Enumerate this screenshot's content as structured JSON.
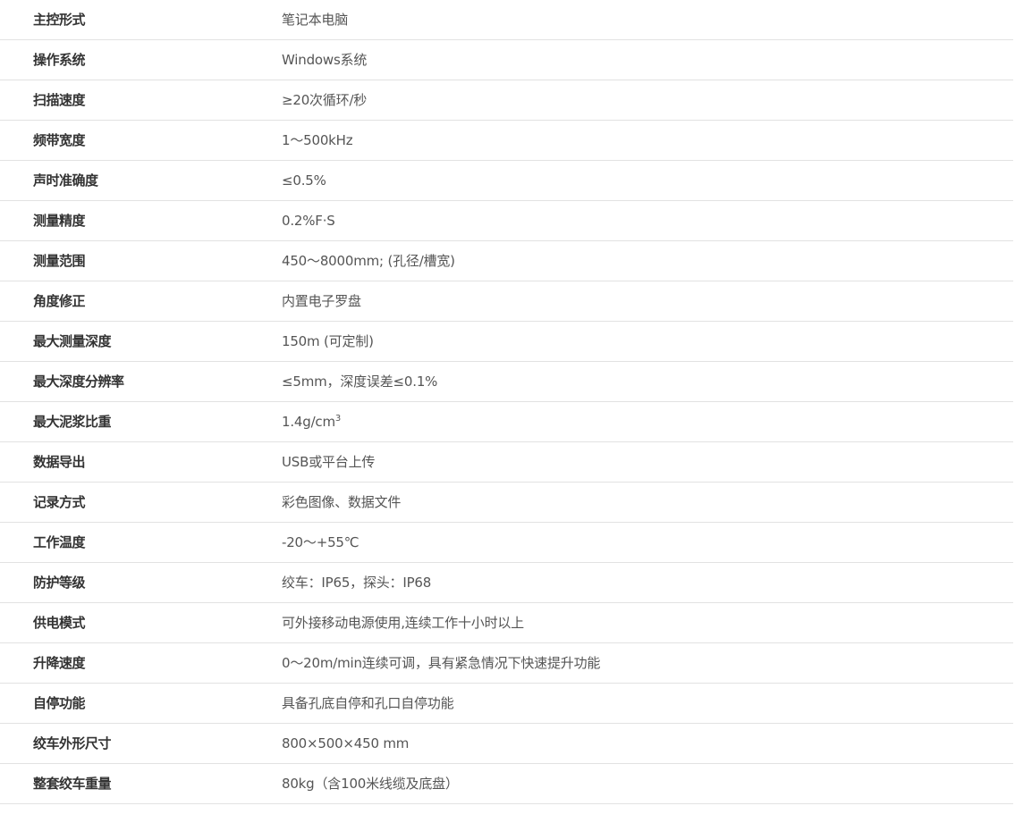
{
  "specs": [
    {
      "label": "主控形式",
      "value": "笔记本电脑"
    },
    {
      "label": "操作系统",
      "value": "Windows系统"
    },
    {
      "label": "扫描速度",
      "value": "≥20次循环/秒"
    },
    {
      "label": "频带宽度",
      "value": "1～500kHz"
    },
    {
      "label": "声时准确度",
      "value": "≤0.5%"
    },
    {
      "label": "测量精度",
      "value": "0.2%F·S"
    },
    {
      "label": "测量范围",
      "value": "450～8000mm; (孔径/槽宽)"
    },
    {
      "label": "角度修正",
      "value": "内置电子罗盘"
    },
    {
      "label": "最大测量深度",
      "value": "150m (可定制)"
    },
    {
      "label": "最大深度分辨率",
      "value": "≤5mm，深度误差≤0.1%"
    },
    {
      "label": "最大泥浆比重",
      "value": "1.4g/cm",
      "sup": "3"
    },
    {
      "label": "数据导出",
      "value": "USB或平台上传"
    },
    {
      "label": "记录方式",
      "value": "彩色图像、数据文件"
    },
    {
      "label": "工作温度",
      "value": "-20～+55℃"
    },
    {
      "label": "防护等级",
      "value": "绞车：IP65，探头：IP68"
    },
    {
      "label": "供电模式",
      "value": "可外接移动电源使用,连续工作十小时以上"
    },
    {
      "label": "升降速度",
      "value": "0～20m/min连续可调，具有紧急情况下快速提升功能"
    },
    {
      "label": "自停功能",
      "value": "具备孔底自停和孔口自停功能"
    },
    {
      "label": "绞车外形尺寸",
      "value": "800×500×450 mm"
    },
    {
      "label": "整套绞车重量",
      "value": "80kg（含100米线缆及底盘）"
    }
  ]
}
